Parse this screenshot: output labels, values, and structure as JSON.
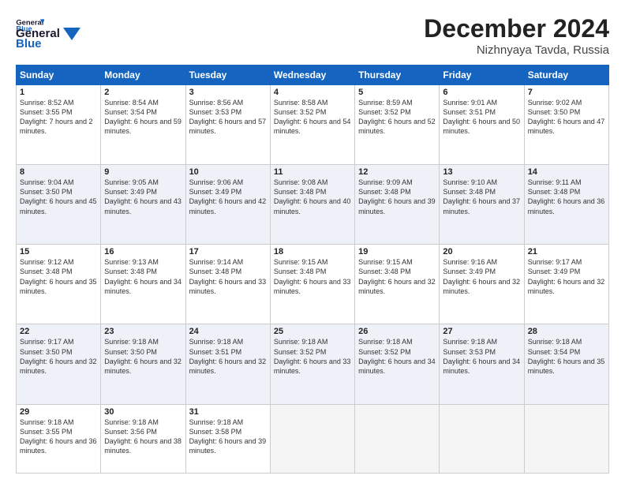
{
  "logo": {
    "line1": "General",
    "line2": "Blue"
  },
  "header": {
    "month": "December 2024",
    "location": "Nizhnyaya Tavda, Russia"
  },
  "weekdays": [
    "Sunday",
    "Monday",
    "Tuesday",
    "Wednesday",
    "Thursday",
    "Friday",
    "Saturday"
  ],
  "weeks": [
    [
      {
        "day": "1",
        "rise": "8:52 AM",
        "set": "3:55 PM",
        "daylight": "7 hours and 2 minutes."
      },
      {
        "day": "2",
        "rise": "8:54 AM",
        "set": "3:54 PM",
        "daylight": "6 hours and 59 minutes."
      },
      {
        "day": "3",
        "rise": "8:56 AM",
        "set": "3:53 PM",
        "daylight": "6 hours and 57 minutes."
      },
      {
        "day": "4",
        "rise": "8:58 AM",
        "set": "3:52 PM",
        "daylight": "6 hours and 54 minutes."
      },
      {
        "day": "5",
        "rise": "8:59 AM",
        "set": "3:52 PM",
        "daylight": "6 hours and 52 minutes."
      },
      {
        "day": "6",
        "rise": "9:01 AM",
        "set": "3:51 PM",
        "daylight": "6 hours and 50 minutes."
      },
      {
        "day": "7",
        "rise": "9:02 AM",
        "set": "3:50 PM",
        "daylight": "6 hours and 47 minutes."
      }
    ],
    [
      {
        "day": "8",
        "rise": "9:04 AM",
        "set": "3:50 PM",
        "daylight": "6 hours and 45 minutes."
      },
      {
        "day": "9",
        "rise": "9:05 AM",
        "set": "3:49 PM",
        "daylight": "6 hours and 43 minutes."
      },
      {
        "day": "10",
        "rise": "9:06 AM",
        "set": "3:49 PM",
        "daylight": "6 hours and 42 minutes."
      },
      {
        "day": "11",
        "rise": "9:08 AM",
        "set": "3:48 PM",
        "daylight": "6 hours and 40 minutes."
      },
      {
        "day": "12",
        "rise": "9:09 AM",
        "set": "3:48 PM",
        "daylight": "6 hours and 39 minutes."
      },
      {
        "day": "13",
        "rise": "9:10 AM",
        "set": "3:48 PM",
        "daylight": "6 hours and 37 minutes."
      },
      {
        "day": "14",
        "rise": "9:11 AM",
        "set": "3:48 PM",
        "daylight": "6 hours and 36 minutes."
      }
    ],
    [
      {
        "day": "15",
        "rise": "9:12 AM",
        "set": "3:48 PM",
        "daylight": "6 hours and 35 minutes."
      },
      {
        "day": "16",
        "rise": "9:13 AM",
        "set": "3:48 PM",
        "daylight": "6 hours and 34 minutes."
      },
      {
        "day": "17",
        "rise": "9:14 AM",
        "set": "3:48 PM",
        "daylight": "6 hours and 33 minutes."
      },
      {
        "day": "18",
        "rise": "9:15 AM",
        "set": "3:48 PM",
        "daylight": "6 hours and 33 minutes."
      },
      {
        "day": "19",
        "rise": "9:15 AM",
        "set": "3:48 PM",
        "daylight": "6 hours and 32 minutes."
      },
      {
        "day": "20",
        "rise": "9:16 AM",
        "set": "3:49 PM",
        "daylight": "6 hours and 32 minutes."
      },
      {
        "day": "21",
        "rise": "9:17 AM",
        "set": "3:49 PM",
        "daylight": "6 hours and 32 minutes."
      }
    ],
    [
      {
        "day": "22",
        "rise": "9:17 AM",
        "set": "3:50 PM",
        "daylight": "6 hours and 32 minutes."
      },
      {
        "day": "23",
        "rise": "9:18 AM",
        "set": "3:50 PM",
        "daylight": "6 hours and 32 minutes."
      },
      {
        "day": "24",
        "rise": "9:18 AM",
        "set": "3:51 PM",
        "daylight": "6 hours and 32 minutes."
      },
      {
        "day": "25",
        "rise": "9:18 AM",
        "set": "3:52 PM",
        "daylight": "6 hours and 33 minutes."
      },
      {
        "day": "26",
        "rise": "9:18 AM",
        "set": "3:52 PM",
        "daylight": "6 hours and 34 minutes."
      },
      {
        "day": "27",
        "rise": "9:18 AM",
        "set": "3:53 PM",
        "daylight": "6 hours and 34 minutes."
      },
      {
        "day": "28",
        "rise": "9:18 AM",
        "set": "3:54 PM",
        "daylight": "6 hours and 35 minutes."
      }
    ],
    [
      {
        "day": "29",
        "rise": "9:18 AM",
        "set": "3:55 PM",
        "daylight": "6 hours and 36 minutes."
      },
      {
        "day": "30",
        "rise": "9:18 AM",
        "set": "3:56 PM",
        "daylight": "6 hours and 38 minutes."
      },
      {
        "day": "31",
        "rise": "9:18 AM",
        "set": "3:58 PM",
        "daylight": "6 hours and 39 minutes."
      },
      null,
      null,
      null,
      null
    ]
  ],
  "labels": {
    "sunrise": "Sunrise:",
    "sunset": "Sunset:",
    "daylight": "Daylight:"
  }
}
